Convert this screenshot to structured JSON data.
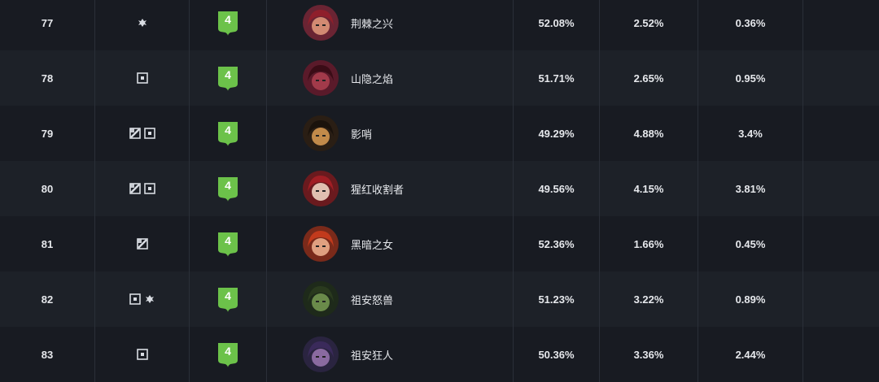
{
  "rows": [
    {
      "rank": "77",
      "positions": [
        "support"
      ],
      "tier": "4",
      "hero": "荆棘之兴",
      "win_rate": "52.08%",
      "pick_rate": "2.52%",
      "ban_rate": "0.36%",
      "portrait": {
        "bg": "#6a2433",
        "face": "#d28a72",
        "hair": "#8f1f2b"
      }
    },
    {
      "rank": "78",
      "positions": [
        "jungle"
      ],
      "tier": "4",
      "hero": "山隐之焰",
      "win_rate": "51.71%",
      "pick_rate": "2.65%",
      "ban_rate": "0.95%",
      "portrait": {
        "bg": "#5a1a2a",
        "face": "#a23a4a",
        "hair": "#3a0c16"
      }
    },
    {
      "rank": "79",
      "positions": [
        "top",
        "jungle"
      ],
      "tier": "4",
      "hero": "影哨",
      "win_rate": "49.29%",
      "pick_rate": "4.88%",
      "ban_rate": "3.4%",
      "portrait": {
        "bg": "#2a1e14",
        "face": "#c28a4a",
        "hair": "#1a120c"
      }
    },
    {
      "rank": "80",
      "positions": [
        "top",
        "jungle"
      ],
      "tier": "4",
      "hero": "猩红收割者",
      "win_rate": "49.56%",
      "pick_rate": "4.15%",
      "ban_rate": "3.81%",
      "portrait": {
        "bg": "#6a1a1e",
        "face": "#e0c0b0",
        "hair": "#a01e24"
      }
    },
    {
      "rank": "81",
      "positions": [
        "top"
      ],
      "tier": "4",
      "hero": "黑暗之女",
      "win_rate": "52.36%",
      "pick_rate": "1.66%",
      "ban_rate": "0.45%",
      "portrait": {
        "bg": "#7a2a1a",
        "face": "#e0a080",
        "hair": "#c23a1c"
      }
    },
    {
      "rank": "82",
      "positions": [
        "jungle",
        "support"
      ],
      "tier": "4",
      "hero": "祖安怒兽",
      "win_rate": "51.23%",
      "pick_rate": "3.22%",
      "ban_rate": "0.89%",
      "portrait": {
        "bg": "#1e2a1a",
        "face": "#6a8a4a",
        "hair": "#2a3a1e"
      }
    },
    {
      "rank": "83",
      "positions": [
        "jungle"
      ],
      "tier": "4",
      "hero": "祖安狂人",
      "win_rate": "50.36%",
      "pick_rate": "3.36%",
      "ban_rate": "2.44%",
      "portrait": {
        "bg": "#2a2440",
        "face": "#8a6aa0",
        "hair": "#3a2a5a"
      }
    }
  ],
  "colors": {
    "tier_badge": "#6cc24a",
    "icon": "#d8dce2"
  },
  "icons": {
    "top": "top-lane-icon",
    "jungle": "jungle-icon",
    "support": "support-icon"
  }
}
